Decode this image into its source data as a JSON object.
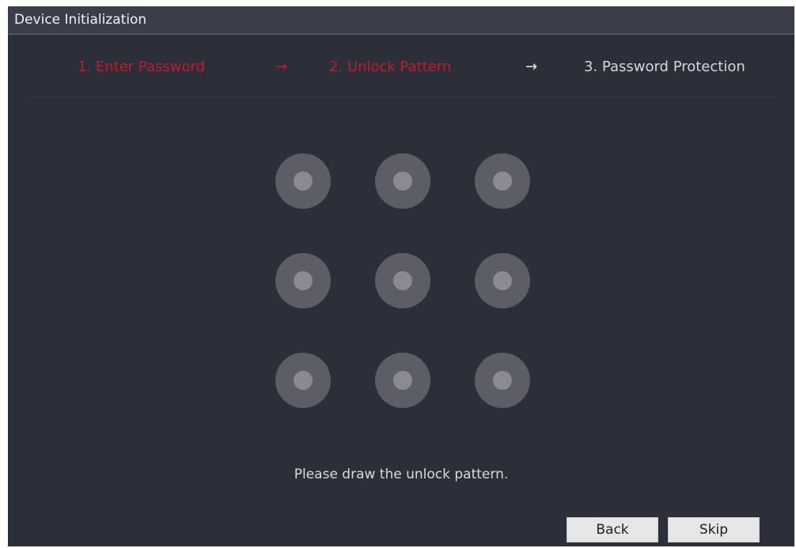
{
  "window": {
    "title": "Device Initialization"
  },
  "steps": [
    {
      "label": "1.  Enter Password",
      "state": "active"
    },
    {
      "label": "2.  Unlock Pattern",
      "state": "active"
    },
    {
      "label": "3.  Password Protection",
      "state": "pending"
    }
  ],
  "arrows": [
    "→",
    "→"
  ],
  "pattern": {
    "rows": 3,
    "cols": 3,
    "hint": "Please draw the unlock pattern."
  },
  "footer": {
    "back_label": "Back",
    "skip_label": "Skip"
  },
  "colors": {
    "active_step": "#c41a2b",
    "background": "#2b2f39",
    "titlebar": "#3a3e48",
    "dot_outer": "#5b5e66",
    "dot_inner": "#898b91"
  }
}
